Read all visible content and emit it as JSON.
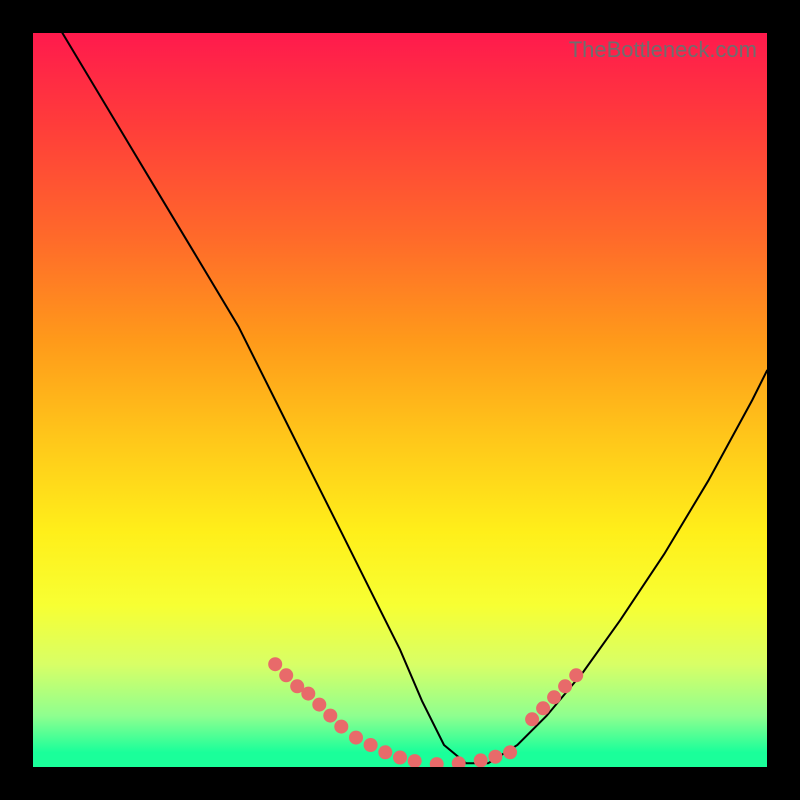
{
  "watermark": "TheBottleneck.com",
  "colors": {
    "page_bg": "#000000",
    "gradient_top": "#ff1a4d",
    "gradient_bottom": "#1aff9a",
    "curve_stroke": "#000000",
    "dot_fill": "#e86a6a"
  },
  "chart_data": {
    "type": "line",
    "title": "",
    "xlabel": "",
    "ylabel": "",
    "xlim": [
      0,
      100
    ],
    "ylim": [
      0,
      100
    ],
    "grid": false,
    "legend": false,
    "description": "V-shaped bottleneck curve over rainbow gradient; minimum near x≈55, y≈0. Left branch steep descending from top-left, right branch rising more gently toward upper-right. Salmon dots clustered along both arms near the bottom 15% of the chart.",
    "series": [
      {
        "name": "bottleneck-curve",
        "x": [
          4,
          10,
          16,
          22,
          28,
          33,
          38,
          42,
          46,
          50,
          53,
          56,
          59,
          62,
          66,
          70,
          75,
          80,
          86,
          92,
          98,
          100
        ],
        "values": [
          100,
          90,
          80,
          70,
          60,
          50,
          40,
          32,
          24,
          16,
          9,
          3,
          0.5,
          0.5,
          3,
          7,
          13,
          20,
          29,
          39,
          50,
          54
        ]
      }
    ],
    "dots": {
      "name": "highlight-dots",
      "x": [
        33,
        34.5,
        36,
        37.5,
        39,
        40.5,
        42,
        44,
        46,
        48,
        50,
        52,
        55,
        58,
        61,
        63,
        65,
        68,
        69.5,
        71,
        72.5,
        74
      ],
      "values": [
        14,
        12.5,
        11,
        10,
        8.5,
        7,
        5.5,
        4,
        3,
        2,
        1.3,
        0.8,
        0.4,
        0.5,
        0.9,
        1.4,
        2,
        6.5,
        8,
        9.5,
        11,
        12.5
      ]
    }
  }
}
